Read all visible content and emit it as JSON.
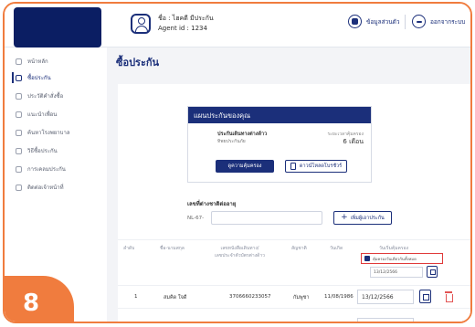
{
  "header": {
    "user_name": "ชื่อ : ไฮคดี มีประกัน",
    "agent_id": "Agent id : 1234",
    "profile_label": "ข้อมูลส่วนตัว",
    "logout_label": "ออกจากระบบ"
  },
  "sidebar": {
    "items": [
      {
        "label": "หน้าหลัก",
        "icon": "home-icon"
      },
      {
        "label": "ซื้อประกัน",
        "icon": "shield-icon"
      },
      {
        "label": "ประวัติคำสั่งซื้อ",
        "icon": "history-icon"
      },
      {
        "label": "แนะนำเพื่อน",
        "icon": "users-icon"
      },
      {
        "label": "ค้นหาโรงพยาบาล",
        "icon": "search-icon"
      },
      {
        "label": "วิธีซื้อประกัน",
        "icon": "book-icon"
      },
      {
        "label": "การเคลมประกัน",
        "icon": "claim-icon"
      },
      {
        "label": "ติดต่อเจ้าหน้าที่",
        "icon": "contact-icon"
      }
    ],
    "active_index": 1
  },
  "page": {
    "title": "ซื้อประกัน"
  },
  "plan": {
    "header": "แผนประกันของคุณ",
    "name": "ประกันเดินทางต่างด้าว",
    "company": "ทิพยประกันภัย",
    "period_label": "ระยะเวลาคุ้มครอง",
    "period_value": "6 เดือน",
    "coverage_button": "ดูความคุ้มครอง",
    "brochure_button": "ดาวน์โหลดโบรชัวร์"
  },
  "reference": {
    "label": "เลขที่ต่างชาติต่ออายุ",
    "prefix": "NL-67-",
    "input_value": "",
    "add_button": "เพิ่มผู้เอาประกัน"
  },
  "table": {
    "headers": {
      "no": "ลำดับ",
      "name": "ชื่อ-นามสกุล",
      "passport": "เลขหนังสือเดินทาง/\nเลขประจำตัวบัตรต่างด้าว",
      "nationality": "สัญชาติ",
      "birth": "วันเกิด",
      "start": "วันเริ่มคุ้มครอง"
    },
    "checkbox_label": "คุ้มครองวันเดียวกันทั้งหมด",
    "header_date": "13/12/2566",
    "rows": [
      {
        "no": "1",
        "name": "สมคิด ใจดี",
        "passport": "3706660233057",
        "nationality": "กัมพูชา",
        "birth": "11/08/1986",
        "start": "13/12/2566"
      }
    ]
  },
  "badge": {
    "step": "8"
  },
  "colors": {
    "brand": "#1b2f7a",
    "accent": "#f07c3e",
    "highlight": "#e03a3a"
  }
}
